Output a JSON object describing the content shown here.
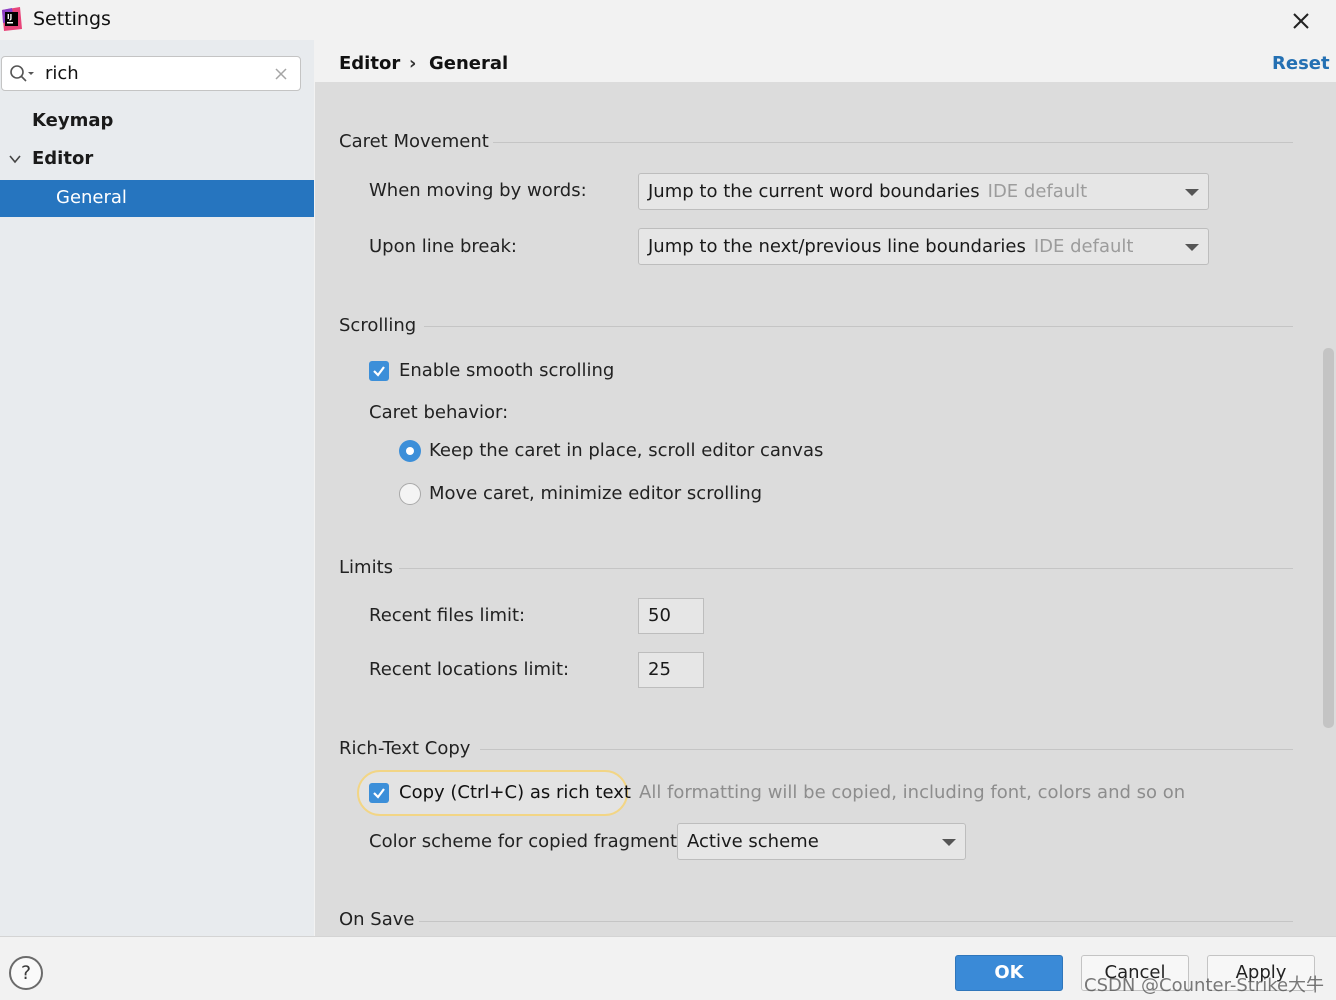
{
  "window": {
    "title": "Settings",
    "app_icon": "intellij-idea-icon"
  },
  "search": {
    "value": "rich"
  },
  "sidebar": {
    "items": [
      {
        "label": "Keymap"
      },
      {
        "label": "Editor",
        "expanded": true
      },
      {
        "label": "General",
        "selected": true
      }
    ]
  },
  "header": {
    "breadcrumb": [
      "Editor",
      "General"
    ],
    "separator": "›",
    "reset_label": "Reset"
  },
  "sections": {
    "caret_movement": {
      "title": "Caret Movement",
      "words_label": "When moving by words:",
      "words_value": "Jump to the current word boundaries",
      "words_hint": "IDE default",
      "line_break_label": "Upon line break:",
      "line_break_value": "Jump to the next/previous line boundaries",
      "line_break_hint": "IDE default"
    },
    "scrolling": {
      "title": "Scrolling",
      "smooth_label": "Enable smooth scrolling",
      "smooth_checked": true,
      "caret_behavior_label": "Caret behavior:",
      "options": [
        {
          "label": "Keep the caret in place, scroll editor canvas",
          "selected": true
        },
        {
          "label": "Move caret, minimize editor scrolling",
          "selected": false
        }
      ]
    },
    "limits": {
      "title": "Limits",
      "recent_files_label": "Recent files limit:",
      "recent_files_value": "50",
      "recent_locations_label": "Recent locations limit:",
      "recent_locations_value": "25"
    },
    "rich_text_copy": {
      "title": "Rich-Text Copy",
      "copy_label": "Copy (Ctrl+C) as rich text",
      "copy_checked": true,
      "copy_hint": "All formatting will be copied, including font, colors and so on",
      "scheme_label": "Color scheme for copied fragment:",
      "scheme_value": "Active scheme"
    },
    "on_save": {
      "title": "On Save"
    }
  },
  "footer": {
    "help_label": "?",
    "ok_label": "OK",
    "cancel_label": "Cancel",
    "apply_label": "Apply",
    "watermark": "CSDN @Counter-Strike大牛"
  },
  "colors": {
    "accent": "#2675bf",
    "link": "#2470b3",
    "highlight_border": "#f2d585"
  }
}
